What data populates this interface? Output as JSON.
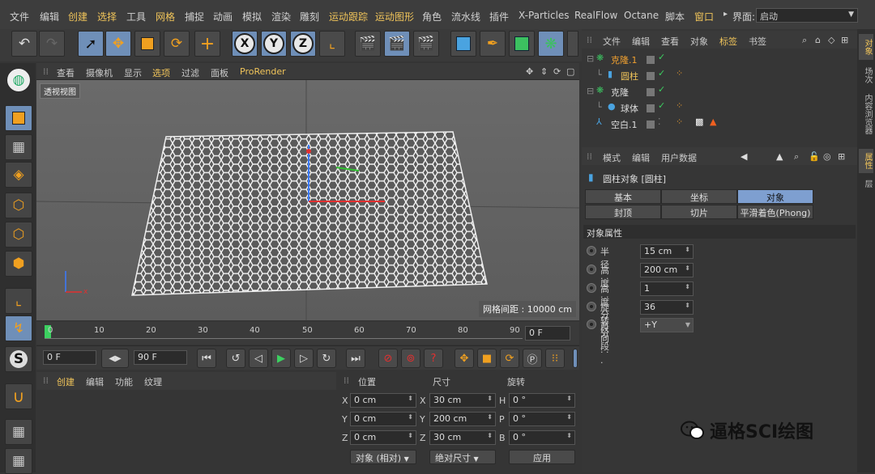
{
  "menubar": {
    "items": [
      "文件",
      "编辑",
      "创建",
      "选择",
      "工具",
      "网格",
      "捕捉",
      "动画",
      "模拟",
      "渲染",
      "雕刻",
      "运动跟踪",
      "运动图形",
      "角色",
      "流水线",
      "插件",
      "X-Particles",
      "RealFlow",
      "Octane",
      "脚本",
      "窗口"
    ],
    "highlighted": [
      "创建",
      "选择",
      "网格",
      "运动跟踪",
      "运动图形",
      "窗口"
    ],
    "layout_label": "界面:",
    "layout_value": "启动"
  },
  "toolbar": {
    "icons": [
      "undo-icon",
      "redo-icon",
      "select-icon",
      "move-icon",
      "scale-icon",
      "rotate-icon",
      "live-add-icon",
      "x-axis-icon",
      "y-axis-icon",
      "z-axis-icon",
      "world-coordinates-icon",
      "render-region-icon",
      "render-view-icon",
      "render-settings-icon",
      "cube-icon",
      "pen-icon",
      "subdivide-icon",
      "cloner-icon"
    ],
    "x": "X",
    "y": "Y",
    "z": "Z"
  },
  "viewport": {
    "menu": [
      "查看",
      "摄像机",
      "显示",
      "选项",
      "过滤",
      "面板",
      "ProRender"
    ],
    "view_label": "透视视图",
    "grid_info": "网格间距 : 10000 cm"
  },
  "timeline": {
    "ticks": [
      "0",
      "10",
      "20",
      "30",
      "40",
      "50",
      "60",
      "70",
      "80",
      "90"
    ],
    "frame_field": "0 F"
  },
  "playbar": {
    "start": "0 F",
    "end": "90 F"
  },
  "material": {
    "menu": [
      "创建",
      "编辑",
      "功能",
      "纹理"
    ]
  },
  "coords": {
    "headers": [
      "位置",
      "尺寸",
      "旋转"
    ],
    "rows": [
      {
        "a": "X",
        "av": "0 cm",
        "b": "X",
        "bv": "30 cm",
        "c": "H",
        "cv": "0 °"
      },
      {
        "a": "Y",
        "av": "0 cm",
        "b": "Y",
        "bv": "200 cm",
        "c": "P",
        "cv": "0 °"
      },
      {
        "a": "Z",
        "av": "0 cm",
        "b": "Z",
        "bv": "30 cm",
        "c": "B",
        "cv": "0 °"
      }
    ],
    "mode": "对象 (相对)",
    "size_mode": "绝对尺寸",
    "apply": "应用"
  },
  "objects": {
    "menu": [
      "文件",
      "编辑",
      "查看",
      "对象",
      "标签",
      "书签"
    ],
    "items": [
      {
        "name": "克隆.1",
        "indent": 0,
        "color": "#f0a030"
      },
      {
        "name": "圆柱",
        "indent": 1,
        "color": "#f0c45a"
      },
      {
        "name": "克隆",
        "indent": 0,
        "color": "#ddd"
      },
      {
        "name": "球体",
        "indent": 1,
        "color": "#ddd"
      },
      {
        "name": "空白.1",
        "indent": 0,
        "color": "#ddd"
      }
    ]
  },
  "attributes": {
    "menu": [
      "模式",
      "编辑",
      "用户数据"
    ],
    "title": "圆柱对象 [圆柱]",
    "tabs_row1": [
      "基本",
      "坐标",
      "对象"
    ],
    "tabs_row2": [
      "封顶",
      "切片",
      "平滑着色(Phong)"
    ],
    "active_tab": "对象",
    "section": "对象属性",
    "props": [
      {
        "label": "半径 . . .",
        "value": "15 cm"
      },
      {
        "label": "高度 . . .",
        "value": "200 cm"
      },
      {
        "label": "高度分段",
        "value": "1"
      },
      {
        "label": "旋转分段",
        "value": "36"
      },
      {
        "label": "方向 . . .",
        "value": "+Y"
      }
    ]
  },
  "right_rail": [
    "对象",
    "场次",
    "内容浏览器",
    "属性",
    "层"
  ],
  "watermark": "逼格SCI绘图"
}
